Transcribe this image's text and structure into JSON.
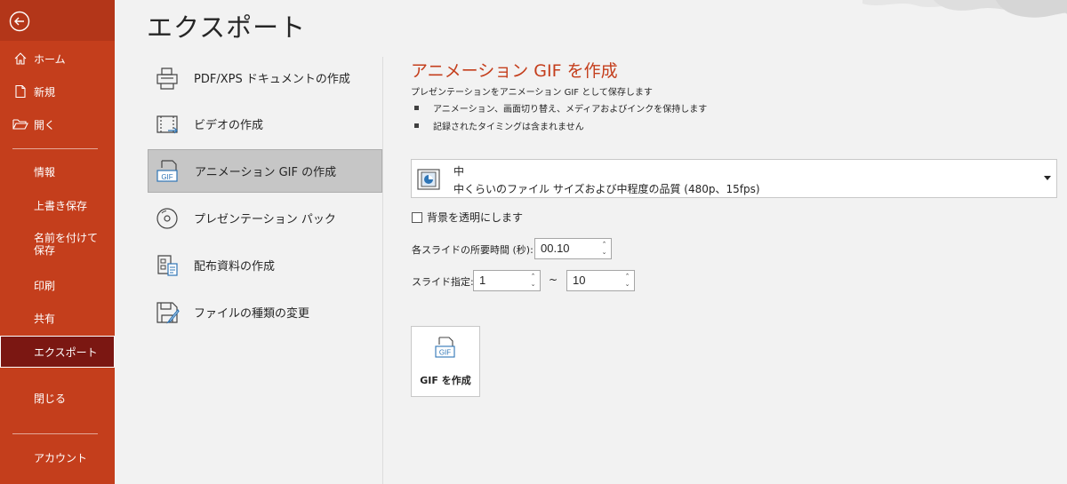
{
  "sidebar": {
    "items": [
      {
        "label": "ホーム",
        "icon": "home-icon"
      },
      {
        "label": "新規",
        "icon": "new-document-icon"
      },
      {
        "label": "開く",
        "icon": "folder-open-icon"
      },
      {
        "label": "情報"
      },
      {
        "label": "上書き保存"
      },
      {
        "label": "名前を付けて保存"
      },
      {
        "label": "印刷"
      },
      {
        "label": "共有"
      },
      {
        "label": "エクスポート",
        "selected": true
      },
      {
        "label": "閉じる"
      },
      {
        "label": "アカウント"
      }
    ],
    "accent": "#c43e1c",
    "selected_color": "#7b1712"
  },
  "page": {
    "title": "エクスポート"
  },
  "export_options": [
    {
      "label": "PDF/XPS ドキュメントの作成",
      "icon": "pdf-document-icon"
    },
    {
      "label": "ビデオの作成",
      "icon": "video-icon"
    },
    {
      "label": "アニメーション GIF の作成",
      "icon": "gif-icon",
      "selected": true
    },
    {
      "label": "プレゼンテーション パック",
      "icon": "cd-package-icon"
    },
    {
      "label": "配布資料の作成",
      "icon": "handout-icon"
    },
    {
      "label": "ファイルの種類の変更",
      "icon": "change-file-type-icon"
    }
  ],
  "detail": {
    "title": "アニメーション GIF を作成",
    "description": "プレゼンテーションをアニメーション GIF として保存します",
    "bullets": [
      "アニメーション、画面切り替え、メディアおよびインクを保持します",
      "記録されたタイミングは含まれません"
    ],
    "quality": {
      "name": "中",
      "description": "中くらいのファイル サイズおよび中程度の品質 (480p、15fps)"
    },
    "transparent_background_label": "背景を透明にします",
    "transparent_background_checked": false,
    "seconds_per_slide_label": "各スライドの所要時間 (秒):",
    "seconds_per_slide_value": "00.10",
    "slide_range_label": "スライド指定:",
    "slide_from": "1",
    "range_separator": "~",
    "slide_to": "10",
    "create_button_label": "GIF を作成"
  }
}
